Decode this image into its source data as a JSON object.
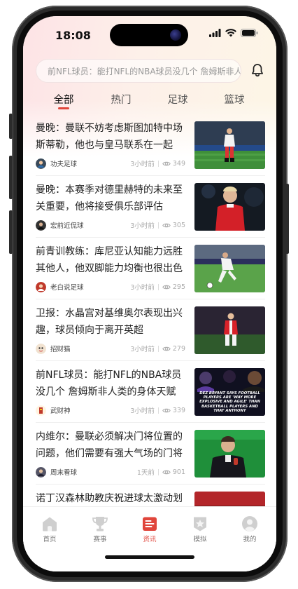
{
  "status_bar": {
    "time": "18:08"
  },
  "search": {
    "text": "前NFL球员：能打NFL的NBA球员没几个 詹姆斯非人类"
  },
  "tabs": [
    {
      "label": "全部",
      "active": true
    },
    {
      "label": "热门",
      "active": false
    },
    {
      "label": "足球",
      "active": false
    },
    {
      "label": "篮球",
      "active": false
    }
  ],
  "feed": [
    {
      "title": "曼晚：曼联不妨考虑斯图加特中场斯蒂勒，他也与皇马联系在一起",
      "author": "功夫足球",
      "time": "3小时前",
      "views": "349"
    },
    {
      "title": "曼晚：本赛季对德里赫特的未来至关重要，他将接受俱乐部评估",
      "author": "宏前近侃球",
      "time": "3小时前",
      "views": "305"
    },
    {
      "title": "前青训教练：库尼亚认知能力远胜其他人，他双脚能力均衡也很出色",
      "author": "老白说足球",
      "time": "3小时前",
      "views": "295"
    },
    {
      "title": "卫报：水晶宫对基维奥尔表现出兴趣，球员倾向于离开英超",
      "author": "招财猫",
      "time": "3小时前",
      "views": "279"
    },
    {
      "title": "前NFL球员：能打NFL的NBA球员没几个 詹姆斯非人类的身体天赋",
      "author": "武财神",
      "time": "3小时前",
      "views": "339"
    },
    {
      "title": "内维尔：曼联必须解决门将位置的问题，他们需要有强大气场的门将",
      "author": "周末看球",
      "time": "1天前",
      "views": "901"
    },
    {
      "title": "诺丁汉森林助教庆祝进球太激动划破头，缝了六针",
      "author": "",
      "time": "",
      "views": ""
    }
  ],
  "thumb_texts": {
    "dez": "DEZ BRYANT SAYS FOOTBALL PLAYERS ARE 'WAY MORE EXPLOSIVE AND AGILE' THAN BASKETBALL PLAYERS AND THAT ANTHONY"
  },
  "tabbar": [
    {
      "label": "首页",
      "icon": "home-icon",
      "active": false
    },
    {
      "label": "赛事",
      "icon": "trophy-icon",
      "active": false
    },
    {
      "label": "资讯",
      "icon": "news-icon",
      "active": true
    },
    {
      "label": "模拟",
      "icon": "star-badge-icon",
      "active": false
    },
    {
      "label": "我的",
      "icon": "profile-icon",
      "active": false
    }
  ],
  "colors": {
    "accent": "#e0453b",
    "inactive_icon": "#c8c8c8"
  }
}
